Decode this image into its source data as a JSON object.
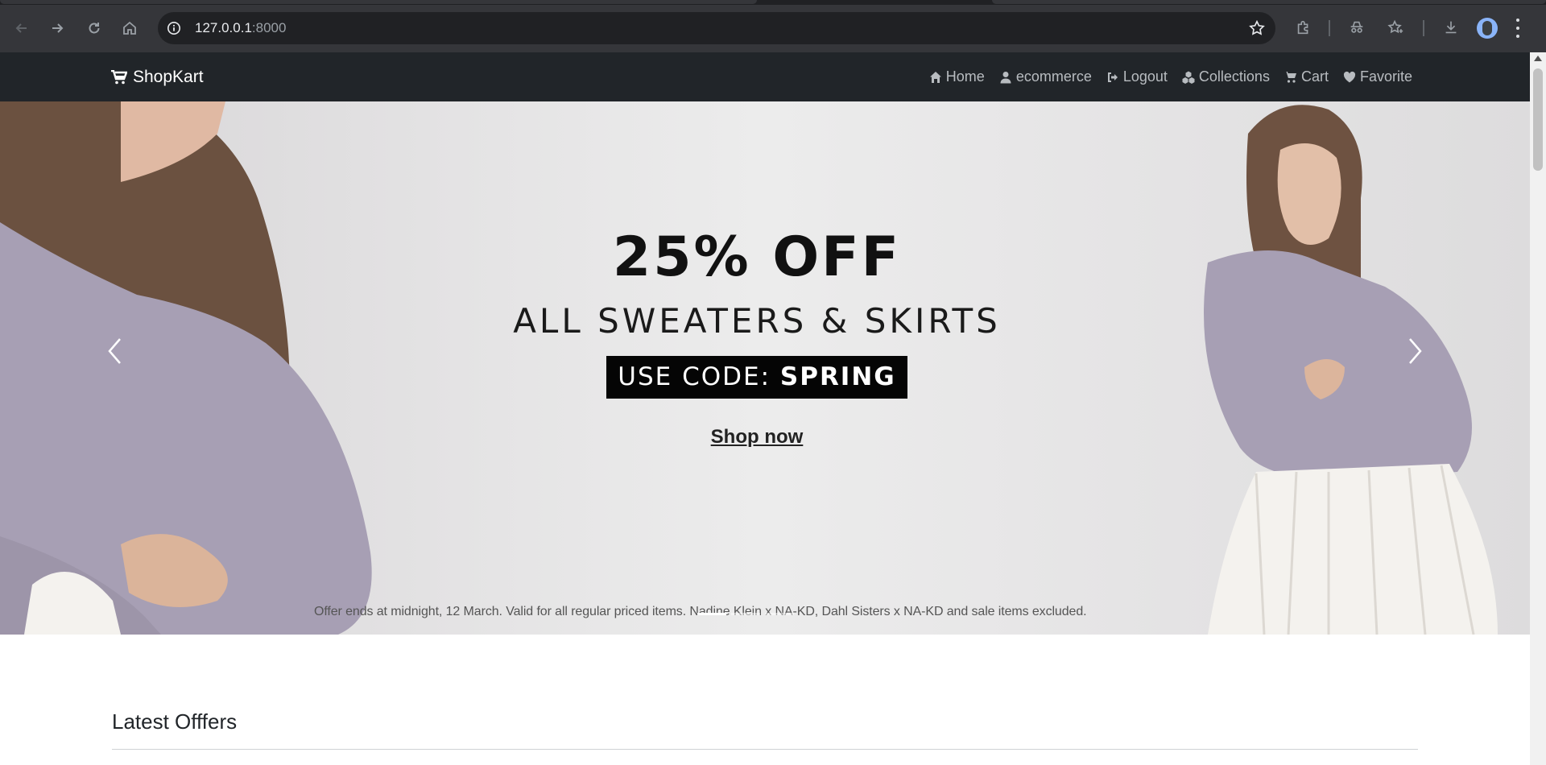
{
  "browser": {
    "url_host": "127.0.0.1",
    "url_port": ":8000"
  },
  "navbar": {
    "brand": "ShopKart",
    "links": [
      {
        "label": "Home",
        "icon": "home-icon"
      },
      {
        "label": "ecommerce",
        "icon": "user-icon"
      },
      {
        "label": "Logout",
        "icon": "logout-icon"
      },
      {
        "label": "Collections",
        "icon": "cubes-icon"
      },
      {
        "label": "Cart",
        "icon": "cart-icon"
      },
      {
        "label": "Favorite",
        "icon": "heart-icon"
      }
    ]
  },
  "hero": {
    "headline": "25% OFF",
    "subhead": "ALL SWEATERS & SKIRTS",
    "code_prefix": "USE CODE: ",
    "code_value": "SPRING",
    "cta": "Shop now",
    "fineprint": "Offer ends at midnight, 12 March. Valid for all regular priced items. Nadine Klein x NA-KD, Dahl Sisters x NA-KD and sale items excluded.",
    "slide_count": 3,
    "active_slide": 1
  },
  "section": {
    "title": "Latest Offfers"
  },
  "colors": {
    "navbar_bg": "#212529",
    "chrome_bg": "#35363a",
    "sweater": "#a79fb4"
  }
}
